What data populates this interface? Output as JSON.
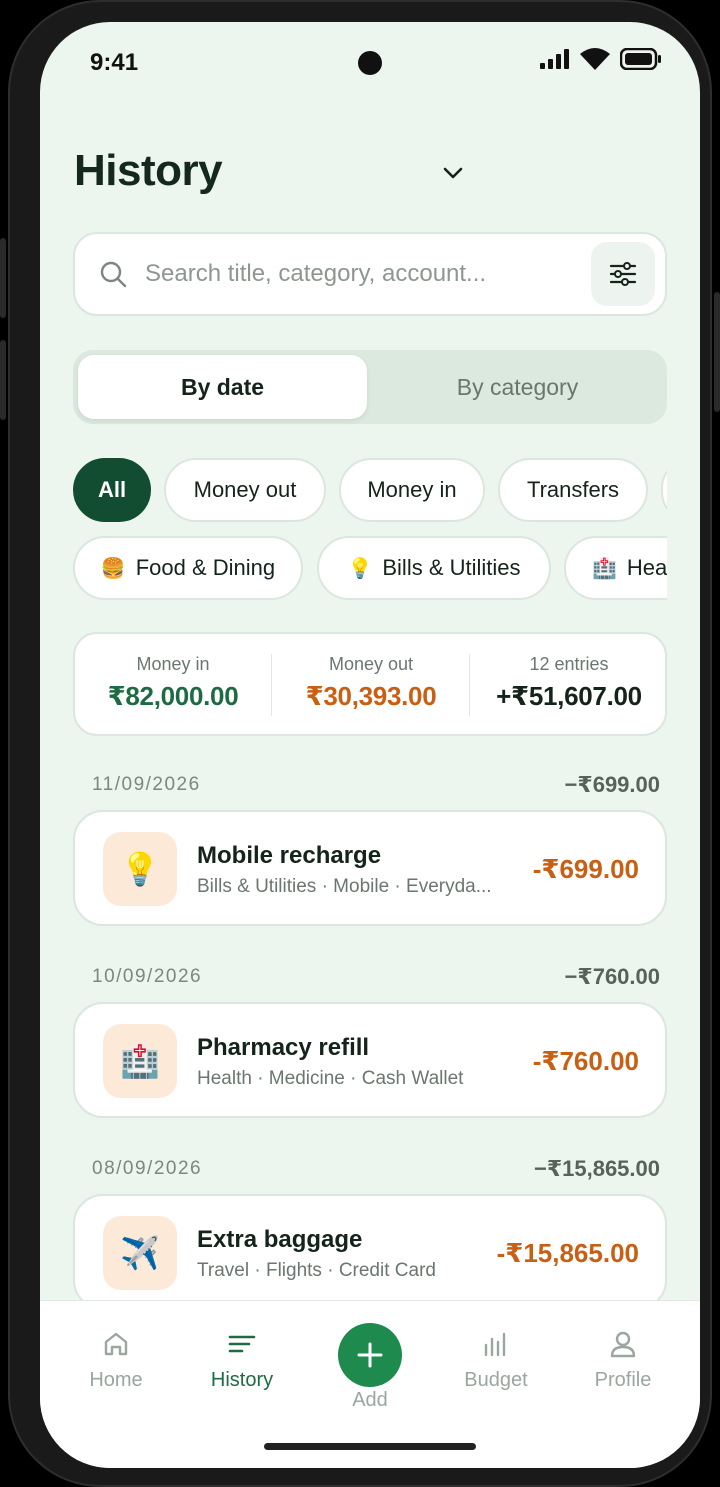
{
  "status": {
    "time": "9:41"
  },
  "header": {
    "title": "History"
  },
  "search": {
    "placeholder": "Search title, category, account..."
  },
  "view_toggle": {
    "options": [
      "By date",
      "By category"
    ],
    "selected": "By date"
  },
  "type_filters": [
    "All",
    "Money out",
    "Money in",
    "Transfers"
  ],
  "category_filters": [
    {
      "icon": "🍔",
      "label": "Food & Dining"
    },
    {
      "icon": "💡",
      "label": "Bills & Utilities"
    },
    {
      "icon": "🏥",
      "label": "Hea"
    }
  ],
  "summary": {
    "money_in_label": "Money in",
    "money_in": "₹82,000.00",
    "money_out_label": "Money out",
    "money_out": "₹30,393.00",
    "entries_label": "12 entries",
    "net": "+₹51,607.00"
  },
  "groups": [
    {
      "date": "11/09/2026",
      "total": "−₹699.00",
      "tx": {
        "icon": "💡",
        "title": "Mobile recharge",
        "subtitle": "Bills & Utilities · Mobile · Everyda...",
        "amount": "-₹699.00"
      }
    },
    {
      "date": "10/09/2026",
      "total": "−₹760.00",
      "tx": {
        "icon": "🏥",
        "title": "Pharmacy refill",
        "subtitle": "Health · Medicine · Cash Wallet",
        "amount": "-₹760.00"
      }
    },
    {
      "date": "08/09/2026",
      "total": "−₹15,865.00",
      "tx": {
        "icon": "✈️",
        "title": "Extra baggage",
        "subtitle": "Travel · Flights · Credit Card",
        "amount": "-₹15,865.00"
      }
    }
  ],
  "nav": {
    "home": "Home",
    "history": "History",
    "add": "Add",
    "budget": "Budget",
    "profile": "Profile",
    "active": "History"
  },
  "colors": {
    "accent": "#124d31",
    "income": "#1e6b43",
    "expense": "#c95f12",
    "background": "#ecf5ee"
  }
}
